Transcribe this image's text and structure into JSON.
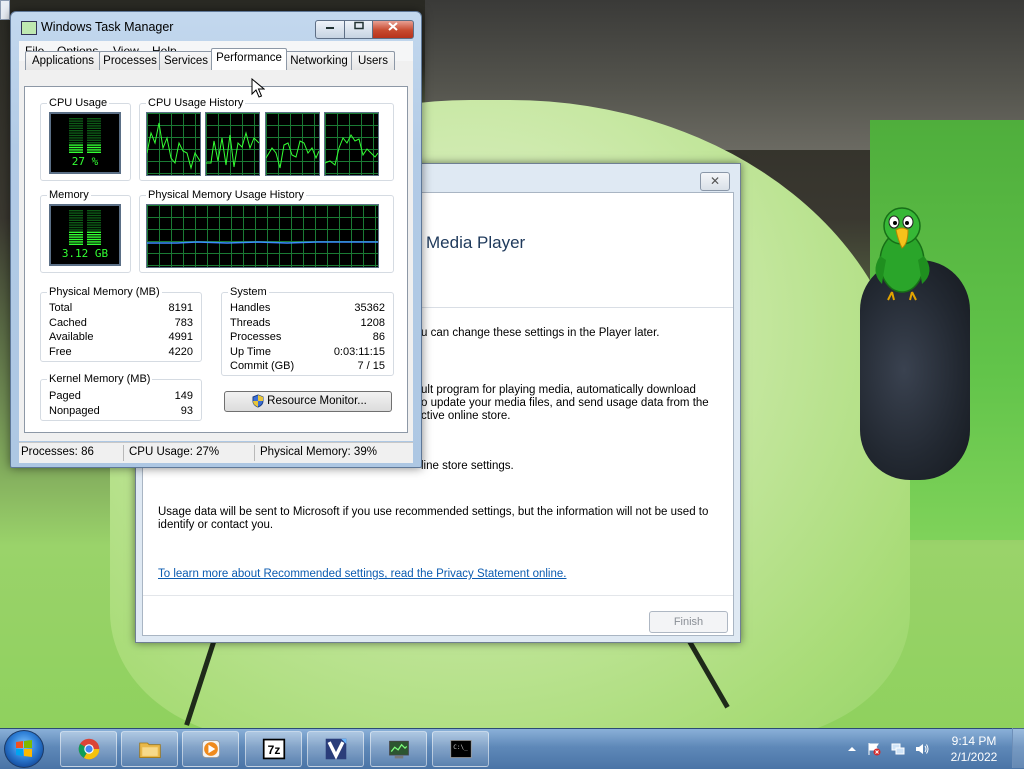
{
  "task_manager": {
    "title": "Windows Task Manager",
    "menu": [
      "File",
      "Options",
      "View",
      "Help"
    ],
    "tabs": [
      "Applications",
      "Processes",
      "Services",
      "Performance",
      "Networking",
      "Users"
    ],
    "active_tab": "Performance",
    "groups": {
      "cpu_usage": "CPU Usage",
      "cpu_history": "CPU Usage History",
      "memory": "Memory",
      "mem_history": "Physical Memory Usage History",
      "physical_memory": "Physical Memory (MB)",
      "kernel_memory": "Kernel Memory (MB)",
      "system": "System"
    },
    "cpu_value": "27 %",
    "cpu_fraction": 0.27,
    "memory_value": "3.12 GB",
    "memory_fraction": 0.39,
    "physical_memory": [
      {
        "label": "Total",
        "value": "8191"
      },
      {
        "label": "Cached",
        "value": "783"
      },
      {
        "label": "Available",
        "value": "4991"
      },
      {
        "label": "Free",
        "value": "4220"
      }
    ],
    "kernel_memory": [
      {
        "label": "Paged",
        "value": "149"
      },
      {
        "label": "Nonpaged",
        "value": "93"
      }
    ],
    "system": [
      {
        "label": "Handles",
        "value": "35362"
      },
      {
        "label": "Threads",
        "value": "1208"
      },
      {
        "label": "Processes",
        "value": "86"
      },
      {
        "label": "Up Time",
        "value": "0:03:11:15"
      },
      {
        "label": "Commit (GB)",
        "value": "7 / 15"
      }
    ],
    "resource_monitor_label": "Resource Monitor...",
    "status": {
      "processes": "Processes: 86",
      "cpu": "CPU Usage: 27%",
      "memory": "Physical Memory: 39%"
    },
    "colors": {
      "meter": "#33ff33",
      "grid": "#1a7a34",
      "mem_line": "#3a8cff"
    }
  },
  "media_player": {
    "heading": "Media Player",
    "line1": "u can change these settings in the Player later.",
    "para": [
      "ult program for playing media, automatically download",
      "o update your media files, and send usage data from the",
      "ctive online store."
    ],
    "line3": "line store settings.",
    "usage": [
      "Usage data will be sent to Microsoft if you use recommended settings, but the information will not be used to",
      "identify or contact you."
    ],
    "link": "To learn more about Recommended settings, read the Privacy Statement online.",
    "finish_label": "Finish",
    "close_glyph": "✕"
  },
  "taskbar": {
    "apps": [
      "chrome-icon",
      "explorer-icon",
      "media-player-icon",
      "7zip-icon",
      "video-editor-icon",
      "task-manager-icon",
      "cmd-icon"
    ],
    "label_7z": "7z",
    "cmd_prompt": "C:\\_",
    "clock_time": "9:14 PM",
    "clock_date": "2/1/2022"
  }
}
